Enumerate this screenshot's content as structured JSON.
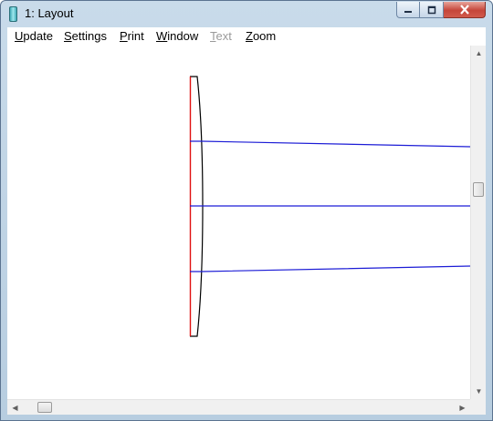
{
  "window": {
    "title": "1: Layout"
  },
  "menu": {
    "items": [
      {
        "label": "Update",
        "mnemonic": "U",
        "rest": "pdate",
        "enabled": true
      },
      {
        "label": "Settings",
        "mnemonic": "S",
        "rest": "ettings",
        "enabled": true
      },
      {
        "label": "Print",
        "mnemonic": "P",
        "rest": "rint",
        "enabled": true
      },
      {
        "label": "Window",
        "mnemonic": "W",
        "rest": "indow",
        "enabled": true
      },
      {
        "label": "Text",
        "mnemonic": "T",
        "rest": "ext",
        "enabled": false
      },
      {
        "label": "Zoom",
        "mnemonic": "Z",
        "rest": "oom",
        "enabled": true
      }
    ]
  },
  "icons": {
    "minimize": "minimize-icon",
    "maximize": "maximize-icon",
    "close": "close-icon",
    "app": "app-icon"
  },
  "colors": {
    "ray": "#1c1cd6",
    "stop_surface": "#e01010",
    "lens_outline": "#000000"
  }
}
